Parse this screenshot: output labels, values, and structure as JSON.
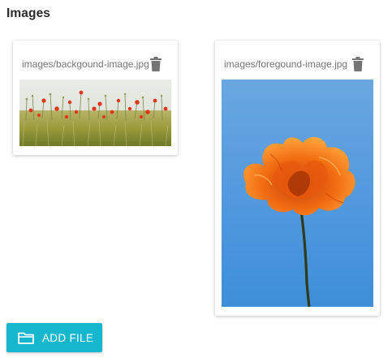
{
  "section": {
    "title": "Images"
  },
  "images": [
    {
      "file_name": "images/backgound-image.jpg",
      "delete_icon": "trash-icon",
      "thumbnail": "poppy-field-photo"
    },
    {
      "file_name": "images/foregound-image.jpg",
      "delete_icon": "trash-icon",
      "thumbnail": "orange-poppy-photo"
    }
  ],
  "actions": {
    "add_file_label": "ADD FILE",
    "add_file_icon": "folder-icon"
  },
  "colors": {
    "accent": "#17b6cf",
    "icon_gray": "#757575",
    "title_text": "#2b2b2b"
  }
}
